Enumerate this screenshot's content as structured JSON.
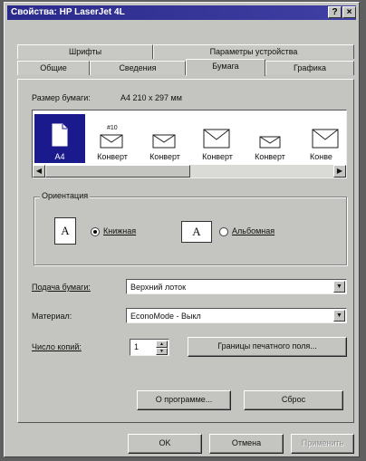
{
  "window": {
    "title": "Свойства: HP LaserJet 4L",
    "help_btn": "?",
    "close_btn": "×"
  },
  "tabs_row1": [
    {
      "label": "Шрифты"
    },
    {
      "label": "Параметры устройства"
    }
  ],
  "tabs_row2": [
    {
      "label": "Общие"
    },
    {
      "label": "Сведения"
    },
    {
      "label": "Бумага"
    },
    {
      "label": "Графика"
    }
  ],
  "paper": {
    "size_label": "Размер бумаги:",
    "size_value": "A4 210 x 297 мм",
    "items": [
      {
        "label": "A4",
        "badge": "",
        "icon": "page-icon"
      },
      {
        "label": "Конверт",
        "badge": "#10",
        "icon": "envelope-icon"
      },
      {
        "label": "Конверт",
        "badge": "",
        "icon": "envelope-icon"
      },
      {
        "label": "Конверт",
        "badge": "",
        "icon": "envelope-icon"
      },
      {
        "label": "Конверт",
        "badge": "",
        "icon": "envelope-icon"
      },
      {
        "label": "Конве",
        "badge": "",
        "icon": "envelope-icon"
      }
    ]
  },
  "orientation": {
    "title": "Ориентация",
    "portrait_label": "Книжная",
    "landscape_label": "Альбомная",
    "icon_letter": "A",
    "selected": "portrait"
  },
  "feed": {
    "label": "Подача бумаги:",
    "value": "Верхний лоток"
  },
  "media": {
    "label": "Материал:",
    "value": "EconoMode - Выкл"
  },
  "copies": {
    "label": "Число копий:",
    "value": "1"
  },
  "buttons": {
    "margins": "Границы печатного поля...",
    "about": "О программе...",
    "reset": "Сброс",
    "ok": "OK",
    "cancel": "Отмена",
    "apply": "Применить"
  },
  "colors": {
    "titlebar": "#2a2a8c",
    "selection": "#1a1a8c",
    "face": "#c4c4c0"
  }
}
